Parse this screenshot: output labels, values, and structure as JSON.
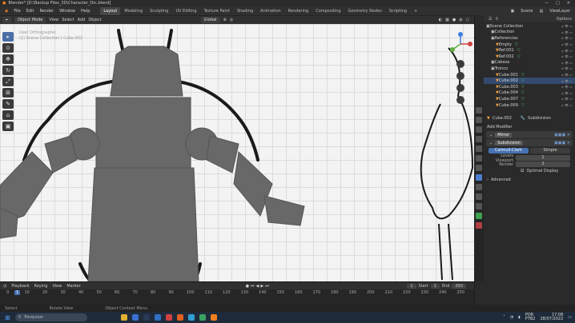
{
  "titlebar": {
    "title": "Blender* [D:\\Backup Files_3D\\Character_Orc.blend]"
  },
  "menu": [
    "File",
    "Edit",
    "Render",
    "Window",
    "Help"
  ],
  "workspaces": [
    "Layout",
    "Modeling",
    "Sculpting",
    "UV Editing",
    "Texture Paint",
    "Shading",
    "Animation",
    "Rendering",
    "Compositing",
    "Geometry Nodes",
    "Scripting"
  ],
  "active_workspace": "Layout",
  "scene": {
    "scene_label": "Scene",
    "view_layer": "ViewLayer"
  },
  "header3d": {
    "mode": "Object Mode",
    "view": "View",
    "select": "Select",
    "add": "Add",
    "object": "Object",
    "orientation": "Global"
  },
  "viewport": {
    "info_line1": "User Orthographic",
    "info_line2": "(1) Scene Collection | Cube.002"
  },
  "outliner": {
    "header": "Scene Collection",
    "options": "Options",
    "rows": [
      {
        "label": "Scene Collection",
        "indent": 0,
        "selected": false
      },
      {
        "label": "Collection",
        "indent": 1,
        "selected": false
      },
      {
        "label": "Referencias",
        "indent": 1,
        "selected": false
      },
      {
        "label": "Empty",
        "indent": 2,
        "selected": false
      },
      {
        "label": "Ref.001",
        "indent": 2,
        "selected": false
      },
      {
        "label": "Ref.002",
        "indent": 2,
        "selected": false
      },
      {
        "label": "Cabeza",
        "indent": 1,
        "selected": false
      },
      {
        "label": "Tronco",
        "indent": 1,
        "selected": false
      },
      {
        "label": "Cube.001",
        "indent": 2,
        "selected": false
      },
      {
        "label": "Cube.002",
        "indent": 2,
        "selected": true
      },
      {
        "label": "Cube.003",
        "indent": 2,
        "selected": false
      },
      {
        "label": "Cube.004",
        "indent": 2,
        "selected": false
      },
      {
        "label": "Cube.007",
        "indent": 2,
        "selected": false
      },
      {
        "label": "Cube.009",
        "indent": 2,
        "selected": false
      }
    ]
  },
  "properties": {
    "object_name": "Cube.002",
    "modifier_tab": "Subdivision",
    "add_modifier": "Add Modifier",
    "modifiers": [
      "Mirror",
      "Subdivision"
    ],
    "mode_buttons": [
      "Catmull-Clark",
      "Simple"
    ],
    "levels_viewport_label": "Levels Viewport",
    "levels_viewport": "1",
    "render_label": "Render",
    "render": "2",
    "optimal_display": "Optimal Display",
    "advanced": "Advanced"
  },
  "timeline": {
    "menu": [
      "Playback",
      "Keying",
      "View",
      "Marker"
    ],
    "current_frame": "1",
    "start_label": "Start",
    "start": "1",
    "end_label": "End",
    "end": "250",
    "ruler": [
      "0",
      "10",
      "20",
      "30",
      "40",
      "50",
      "60",
      "70",
      "80",
      "90",
      "100",
      "110",
      "120",
      "130",
      "140",
      "150",
      "160",
      "170",
      "180",
      "190",
      "200",
      "210",
      "220",
      "230",
      "240",
      "250"
    ]
  },
  "statusbar": [
    "Select",
    "Rotate View",
    "Object Context Menu"
  ],
  "taskbar": {
    "search": "Pesquisar",
    "lang": "POR",
    "lang2": "PTB2",
    "time": "17:08",
    "date": "28/07/2022"
  },
  "colors": {
    "selection": "#334a6e",
    "accent": "#4772b3",
    "mesh_fill": "#686868"
  }
}
